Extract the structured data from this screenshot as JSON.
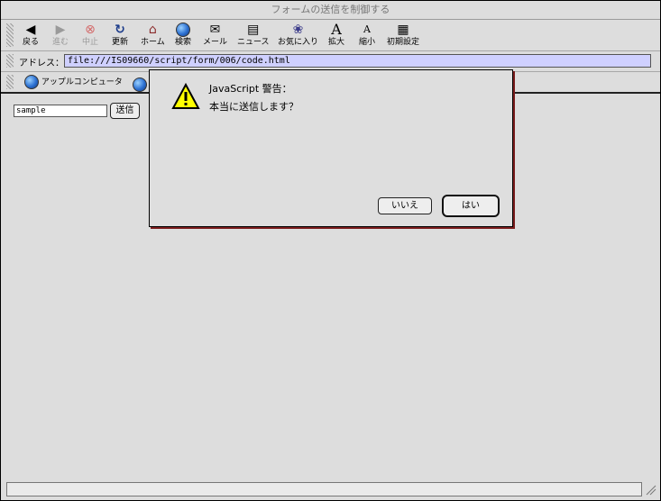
{
  "window": {
    "title": "フォームの送信を制御する"
  },
  "toolbar": {
    "back": "戻る",
    "forward": "進む",
    "stop": "中止",
    "reload": "更新",
    "home": "ホーム",
    "search": "検索",
    "mail": "メール",
    "news": "ニュース",
    "favorites": "お気に入り",
    "larger": "拡大",
    "smaller": "縮小",
    "preferences": "初期設定"
  },
  "address": {
    "label": "アドレス：",
    "url": "file:///IS09660/script/form/006/code.html"
  },
  "links": {
    "item1": "アップルコンピュータ"
  },
  "page": {
    "input_value": "sample",
    "submit_label": "送信"
  },
  "dialog": {
    "title": "JavaScript 警告：",
    "message": "本当に送信します？",
    "cancel_label": "いいえ",
    "ok_label": "はい"
  }
}
